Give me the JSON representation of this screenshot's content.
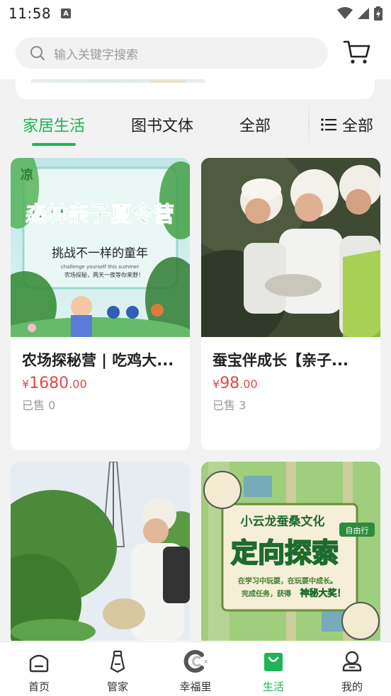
{
  "status_bar": {
    "time": "11:58",
    "notif_letter": "A"
  },
  "search": {
    "placeholder": "输入关键字搜索"
  },
  "tabs": [
    {
      "label": "家居生活",
      "active": true
    },
    {
      "label": "图书文体",
      "active": false
    },
    {
      "label": "全部",
      "active": false
    }
  ],
  "category_menu": {
    "label": "全部"
  },
  "products": [
    {
      "title": "农场探秘营 | 吃鸡大...",
      "price_currency": "¥",
      "price_integer": "1680",
      "price_decimal": ".00",
      "sold": "已售 0",
      "image": {
        "headline": "森林亲子夏令营",
        "line1": "挑战不一样的童年",
        "line2": "challenge yourself this summer",
        "line3": "农场探秘，两天一夜等你来野！",
        "logo": "凉"
      }
    },
    {
      "title": "蚕宝伴成长【亲子...",
      "price_currency": "¥",
      "price_integer": "98",
      "price_decimal": ".00",
      "sold": "已售 3",
      "image": {}
    },
    {
      "title": "",
      "price_currency": "",
      "price_integer": "",
      "price_decimal": "",
      "sold": "",
      "image": {}
    },
    {
      "title": "",
      "price_currency": "",
      "price_integer": "",
      "price_decimal": "",
      "sold": "",
      "image": {
        "headline1": "小云龙蚕桑文化",
        "badge": "自由行",
        "headline2": "定向探索",
        "line1": "在学习中玩耍，在玩耍中成长。",
        "line2": "完成任务，获得",
        "line2_highlight": "神秘大奖！"
      }
    }
  ],
  "bottom_nav": [
    {
      "label": "首页",
      "icon": "home-icon",
      "active": false
    },
    {
      "label": "管家",
      "icon": "butler-tie-icon",
      "active": false
    },
    {
      "label": "幸福里",
      "icon": "happiness-icon",
      "active": false
    },
    {
      "label": "生活",
      "icon": "shopping-bag-icon",
      "active": true
    },
    {
      "label": "我的",
      "icon": "profile-icon",
      "active": false
    }
  ],
  "colors": {
    "accent": "#1fb457",
    "price": "#e24848",
    "background": "#f2f2f2"
  }
}
